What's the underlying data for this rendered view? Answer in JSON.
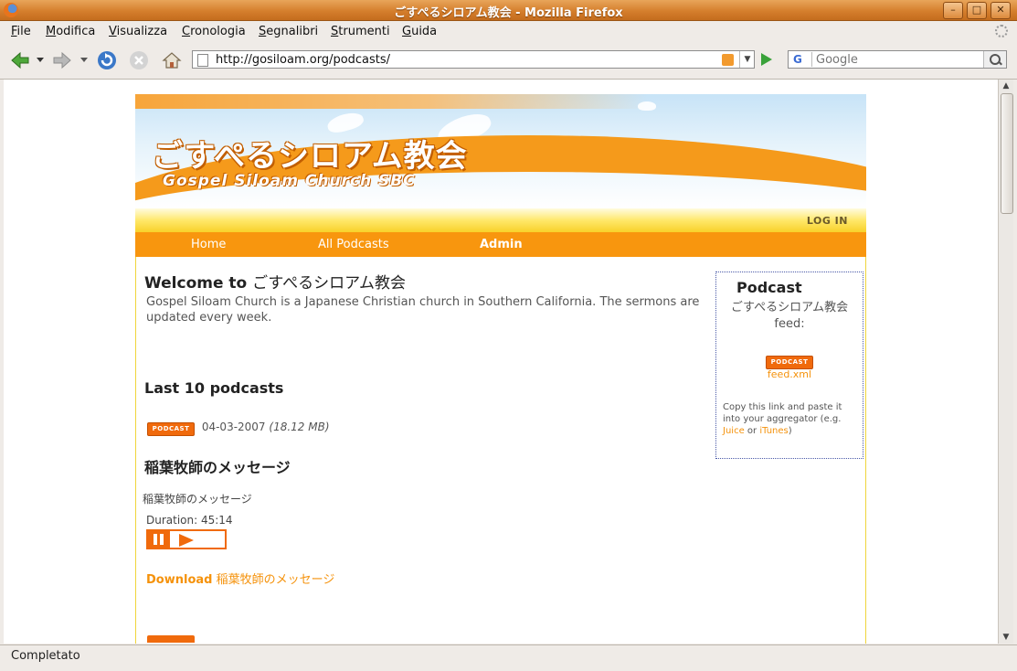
{
  "window": {
    "title": "ごすぺるシロアム教会 - Mozilla Firefox"
  },
  "menu": [
    "File",
    "Modifica",
    "Visualizza",
    "Cronologia",
    "Segnalibri",
    "Strumenti",
    "Guida"
  ],
  "toolbar": {
    "url": "http://gosiloam.org/podcasts/",
    "search_placeholder": "Google",
    "search_engine_icon": "G"
  },
  "status": {
    "text": "Completato"
  },
  "site": {
    "banner_jp": "ごすぺるシロアム教会",
    "banner_en": "Gospel Siloam Church  SBC",
    "login": "LOG IN",
    "nav": [
      "Home",
      "All Podcasts",
      "Admin"
    ]
  },
  "main": {
    "welcome_prefix": "Welcome to",
    "welcome_name": "ごすぺるシロアム教会",
    "intro": "Gospel Siloam Church is a Japanese Christian church in Southern California. The sermons are updated every week.",
    "last_heading": "Last 10 podcasts",
    "episode": {
      "badge": "PODCAST",
      "date": "04-03-2007",
      "size": "(18.12 MB)",
      "title": "稲葉牧師のメッセージ",
      "description": "稲葉牧師のメッセージ",
      "duration": "Duration: 45:14",
      "download_label": "Download",
      "download_title": "稲葉牧師のメッセージ"
    }
  },
  "sidebar": {
    "title": "Podcast",
    "feed_name": "ごすぺるシロアム教会",
    "feed_suffix": "feed:",
    "badge": "PODCAST",
    "feed_file": "feed.xml",
    "help_text": "Copy this link and paste it into your aggregator (e.g.",
    "juice": "Juice",
    "or": "or",
    "itunes": "iTunes",
    "close_paren": ")"
  },
  "colors": {
    "accent_orange": "#f8960e",
    "link_orange": "#f5920b",
    "badge_orange": "#f06a0c",
    "title_bar": "#d57f2d"
  }
}
